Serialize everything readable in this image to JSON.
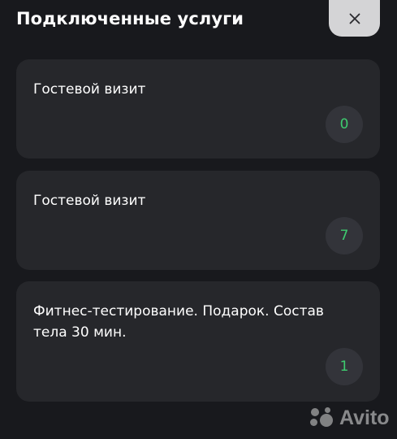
{
  "header": {
    "title": "Подключенные услуги",
    "close_icon": "close-icon"
  },
  "services": [
    {
      "name": "Гостевой визит",
      "count": "0"
    },
    {
      "name": "Гостевой визит",
      "count": "7"
    },
    {
      "name": "Фитнес-тестирование. Подарок. Состав тела 30 мин.",
      "count": "1"
    }
  ],
  "watermark": {
    "text": "Avito"
  },
  "colors": {
    "background": "#18191d",
    "card": "#26272b",
    "badge": "#33343a",
    "accent_green": "#3ecb6f",
    "close_button": "#d4d4d6"
  }
}
